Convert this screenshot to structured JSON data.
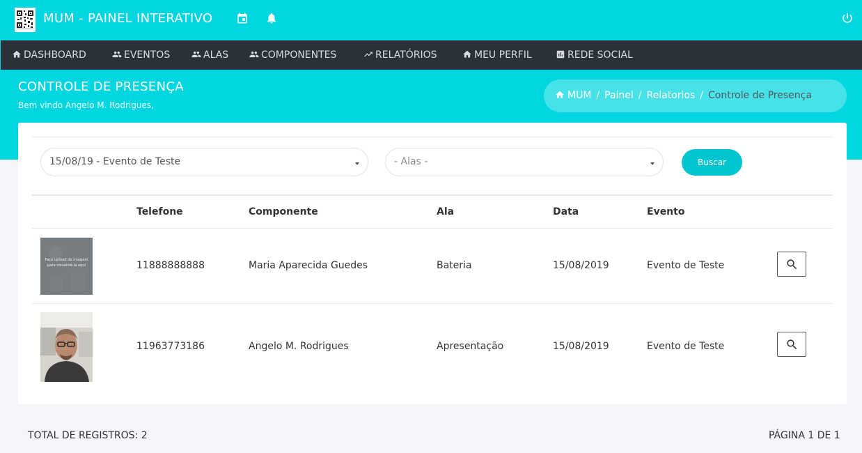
{
  "app": {
    "title": "MUM - PAINEL INTERATIVO"
  },
  "colors": {
    "brand": "#00d6df",
    "nav_bg": "#2a3138",
    "button": "#00c5d0"
  },
  "nav": {
    "items": [
      {
        "icon": "home-icon",
        "label": "DASHBOARD"
      },
      {
        "icon": "people-icon",
        "label": "EVENTOS"
      },
      {
        "icon": "people-icon",
        "label": "ALAS"
      },
      {
        "icon": "people-icon",
        "label": "COMPONENTES"
      },
      {
        "icon": "trending-up-icon",
        "label": "RELATÓRIOS"
      },
      {
        "icon": "home-icon",
        "label": "MEU PERFIL"
      },
      {
        "icon": "bar-chart-icon",
        "label": "REDE SOCIAL"
      }
    ]
  },
  "header": {
    "title": "CONTROLE DE PRESENÇA",
    "welcome": "Bem vindo Angelo M. Rodrigues,"
  },
  "breadcrumb": [
    "MUM",
    "Painel",
    "Relatorios",
    "Controle de Presença"
  ],
  "filters": {
    "evento_selected": "15/08/19 - Evento de Teste",
    "alas_selected": "- Alas -",
    "search_button": "Buscar"
  },
  "table": {
    "columns": [
      "Telefone",
      "Componente",
      "Ala",
      "Data",
      "Evento"
    ],
    "rows": [
      {
        "photo_text": "Faça upload da imagem para visualizá-la aqui",
        "telefone": "11888888888",
        "componente": "Maria Aparecida Guedes",
        "ala": "Bateria",
        "data": "15/08/2019",
        "evento": "Evento de Teste"
      },
      {
        "photo_text": "",
        "telefone": "11963773186",
        "componente": "Angelo M. Rodrigues",
        "ala": "Apresentação",
        "data": "15/08/2019",
        "evento": "Evento de Teste"
      }
    ]
  },
  "footer": {
    "total": "TOTAL DE REGISTROS: 2",
    "page": "PÁGINA 1 DE 1"
  }
}
